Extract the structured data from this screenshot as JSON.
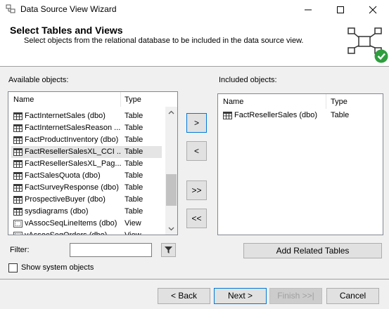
{
  "window": {
    "title": "Data Source View Wizard"
  },
  "header": {
    "title": "Select Tables and Views",
    "subtitle": "Select objects from the relational database to be included in the data source view."
  },
  "available": {
    "label": "Available objects:",
    "columns": {
      "name": "Name",
      "type": "Type"
    },
    "rows": [
      {
        "name": "FactInternetSales (dbo)",
        "type": "Table",
        "icon": "table-icon"
      },
      {
        "name": "FactInternetSalesReason ...",
        "type": "Table",
        "icon": "table-icon"
      },
      {
        "name": "FactProductInventory (dbo)",
        "type": "Table",
        "icon": "table-icon"
      },
      {
        "name": "FactResellerSalesXL_CCI ...",
        "type": "Table",
        "icon": "table-icon"
      },
      {
        "name": "FactResellerSalesXL_Pag...",
        "type": "Table",
        "icon": "table-icon"
      },
      {
        "name": "FactSalesQuota (dbo)",
        "type": "Table",
        "icon": "table-icon"
      },
      {
        "name": "FactSurveyResponse (dbo)",
        "type": "Table",
        "icon": "table-icon"
      },
      {
        "name": "ProspectiveBuyer (dbo)",
        "type": "Table",
        "icon": "table-icon"
      },
      {
        "name": "sysdiagrams (dbo)",
        "type": "Table",
        "icon": "table-icon"
      },
      {
        "name": "vAssocSeqLineItems (dbo)",
        "type": "View",
        "icon": "view-icon"
      },
      {
        "name": "vAssocSeqOrders (dbo)",
        "type": "View",
        "icon": "view-icon"
      }
    ],
    "selected_index": 3
  },
  "included": {
    "label": "Included objects:",
    "columns": {
      "name": "Name",
      "type": "Type"
    },
    "rows": [
      {
        "name": "FactResellerSales (dbo)",
        "type": "Table",
        "icon": "table-icon"
      }
    ]
  },
  "transfer_buttons": {
    "add": ">",
    "remove": "<",
    "add_all": ">>",
    "remove_all": "<<"
  },
  "filter": {
    "label": "Filter:",
    "value": ""
  },
  "add_related_label": "Add Related Tables",
  "show_system_label": "Show system objects",
  "footer": {
    "back": "< Back",
    "next": "Next >",
    "finish": "Finish >>|",
    "cancel": "Cancel"
  },
  "colors": {
    "accent": "#0078d7",
    "selection": "#e5e5e5",
    "check_green": "#2e9e3e"
  }
}
